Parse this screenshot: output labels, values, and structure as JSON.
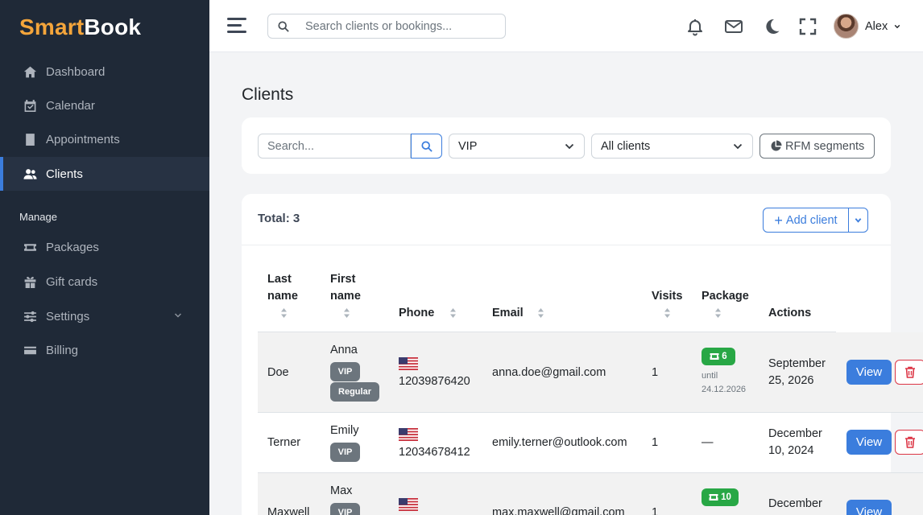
{
  "brand": {
    "part1": "Smart",
    "part2": "Book"
  },
  "sidebar": {
    "items": [
      {
        "label": "Dashboard",
        "icon": "home-icon"
      },
      {
        "label": "Calendar",
        "icon": "calendar-check-icon"
      },
      {
        "label": "Appointments",
        "icon": "book-icon"
      },
      {
        "label": "Clients",
        "icon": "users-icon",
        "active": true
      }
    ],
    "section_title": "Manage",
    "manage_items": [
      {
        "label": "Packages",
        "icon": "ticket-icon"
      },
      {
        "label": "Gift cards",
        "icon": "gift-icon"
      },
      {
        "label": "Settings",
        "icon": "sliders-icon",
        "has_submenu": true
      },
      {
        "label": "Billing",
        "icon": "credit-card-icon"
      }
    ]
  },
  "topbar": {
    "search_placeholder": "Search clients or bookings...",
    "user_name": "Alex"
  },
  "page": {
    "title": "Clients"
  },
  "filters": {
    "search_placeholder": "Search...",
    "segment_value": "VIP",
    "clients_value": "All clients",
    "rfm_label": "RFM segments"
  },
  "table": {
    "total_label": "Total: 3",
    "add_label": "Add client",
    "headers": {
      "last_name_1": "Last",
      "last_name_2": "name",
      "first_name_1": "First",
      "first_name_2": "name",
      "phone": "Phone",
      "email": "Email",
      "visits": "Visits",
      "package": "Package",
      "actions": "Actions"
    },
    "rows": [
      {
        "last_name": "Doe",
        "first_name": "Anna",
        "tags": [
          "VIP",
          "Regular"
        ],
        "phone": "12039876420",
        "email": "anna.doe@gmail.com",
        "visits": "1",
        "package_count": "6",
        "package_until_1": "until",
        "package_until_2": "24.12.2026",
        "date_1": "September",
        "date_2": "25, 2026",
        "view_label": "View"
      },
      {
        "last_name": "Terner",
        "first_name": "Emily",
        "tags": [
          "VIP"
        ],
        "phone": "12034678412",
        "email": "emily.terner@outlook.com",
        "visits": "1",
        "package_none": "—",
        "date_1": "December",
        "date_2": "10, 2024",
        "view_label": "View"
      },
      {
        "last_name": "Maxwell",
        "first_name": "Max",
        "tags": [
          "VIP"
        ],
        "phone": "",
        "email": "max.maxwell@gmail.com",
        "visits": "1",
        "package_count": "10",
        "date_1": "December",
        "date_2": "",
        "view_label": "View"
      }
    ]
  },
  "colors": {
    "accent": "#3b7ddd",
    "brand_orange": "#f4a53b",
    "sidebar_bg": "#1f2937",
    "success": "#28a745",
    "danger": "#dc3545",
    "badge_gray": "#6c757d"
  }
}
